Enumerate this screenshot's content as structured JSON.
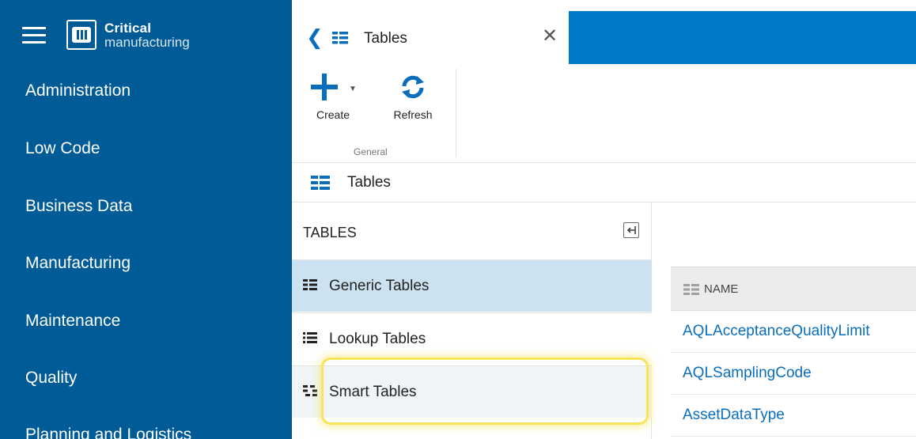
{
  "sidebar": {
    "logo": {
      "line1": "Critical",
      "line2": "manufacturing"
    },
    "items": [
      {
        "label": "Administration"
      },
      {
        "label": "Low Code"
      },
      {
        "label": "Business Data"
      },
      {
        "label": "Manufacturing"
      },
      {
        "label": "Maintenance"
      },
      {
        "label": "Quality"
      },
      {
        "label": "Planning and Logistics"
      }
    ]
  },
  "tab": {
    "title": "Tables"
  },
  "toolbar": {
    "create_label": "Create",
    "refresh_label": "Refresh",
    "group_label": "General"
  },
  "breadcrumb": {
    "label": "Tables"
  },
  "panel": {
    "title": "TABLES",
    "items": [
      {
        "label": "Generic Tables",
        "selected": true
      },
      {
        "label": "Lookup Tables"
      },
      {
        "label": "Smart Tables",
        "highlighted": true
      }
    ]
  },
  "grid": {
    "column": "NAME",
    "rows": [
      {
        "name": "AQLAcceptanceQualityLimit"
      },
      {
        "name": "AQLSamplingCode"
      },
      {
        "name": "AssetDataType"
      }
    ]
  },
  "colors": {
    "sidebar": "#005b96",
    "header": "#0079c8",
    "accent": "#0a6ebd",
    "selected_row": "#cde2f1",
    "highlight": "#f6e45a"
  },
  "icons": [
    "hamburger-icon",
    "logo-icon",
    "chevron-left-icon",
    "table-icon",
    "close-icon",
    "plus-icon",
    "refresh-icon",
    "collapse-panel-icon",
    "generic-tables-icon",
    "lookup-tables-icon",
    "smart-tables-icon",
    "column-icon"
  ]
}
